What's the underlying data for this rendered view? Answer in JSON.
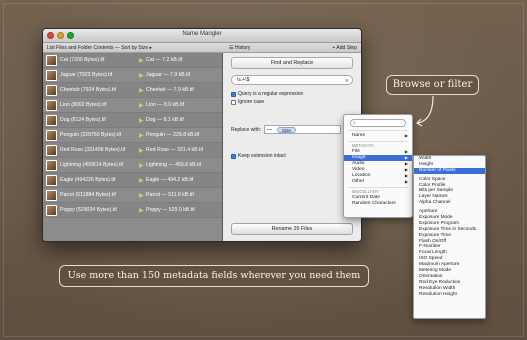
{
  "window": {
    "title": "Name Mangler",
    "toolbar_left": "List Files and Folder Contents  —  Sort by Size ▸",
    "toolbar_mid": "History",
    "toolbar_right": "+ Add Step"
  },
  "files": [
    {
      "name": "Cat (7200 Bytes).tif",
      "newname": "Cat — 7.2 kB.tif"
    },
    {
      "name": "Jaguar (7923 Bytes).tif",
      "newname": "Jaguar — 7.9 kB.tif"
    },
    {
      "name": "Cheetah (7924 Bytes).tif",
      "newname": "Cheetah — 7.9 kB.tif"
    },
    {
      "name": "Lion (8002 Bytes).tif",
      "newname": "Lion — 8.0 kB.tif"
    },
    {
      "name": "Dog (8124 Bytes).tif",
      "newname": "Dog — 8.1 kB.tif"
    },
    {
      "name": "Penguin (229750 Bytes).tif",
      "newname": "Penguin — 229.8 kB.tif"
    },
    {
      "name": "Red Rose (331408 Bytes).tif",
      "newname": "Red Rose — 331.4 kB.tif"
    },
    {
      "name": "Lightning (450614 Bytes).tif",
      "newname": "Lightning — 450.6 kB.tif"
    },
    {
      "name": "Eagle (494226 Bytes).tif",
      "newname": "Eagle — 494.2 kB.tif"
    },
    {
      "name": "Parrot (511884 Bytes).tif",
      "newname": "Parrot — 511.9 kB.tif"
    },
    {
      "name": "Poppy (529034 Bytes).tif",
      "newname": "Poppy — 529.0 kB.tif"
    }
  ],
  "step": {
    "tab_label": "Find and Replace",
    "find_value": "\\s.+\\$",
    "regex_label": "Query is a regular expression",
    "ignore_case_label": "Ignore case",
    "replace_label": "Replace with:",
    "replace_prefix": "—",
    "token_label": "Size",
    "keep_ext_label": "Keep extension intact",
    "rename_button": "Rename 26 Files"
  },
  "popup": {
    "name": "Name",
    "metadata_header": "METADATA",
    "file": "File",
    "image": "Image",
    "audio": "Audio",
    "video": "Video",
    "location": "Location",
    "other": "Other",
    "misc_header": "MISCELLANY",
    "current_date": "Current Date",
    "random_chars": "Random Characters"
  },
  "submenu_items": [
    "Width",
    "Height",
    "Number of Pixels",
    "",
    "Color Space",
    "Color Profile",
    "Bits per Sample",
    "Layer Names",
    "Alpha Channel",
    "",
    "Aperture",
    "Exposure Mode",
    "Exposure Program",
    "Exposure Time in Seconds",
    "Exposure Time",
    "Flash On/Off",
    "F-Number",
    "Focal Length",
    "ISO Speed",
    "Maximum Aperture",
    "Metering Mode",
    "Orientation",
    "Red Eye Reduction",
    "Resolution Width",
    "Resolution Height"
  ],
  "submenu_highlight": "Number of Pixels",
  "callouts": {
    "filter": "Browse or filter",
    "metadata": "Use more than 150 metadata fields wherever you need them"
  }
}
